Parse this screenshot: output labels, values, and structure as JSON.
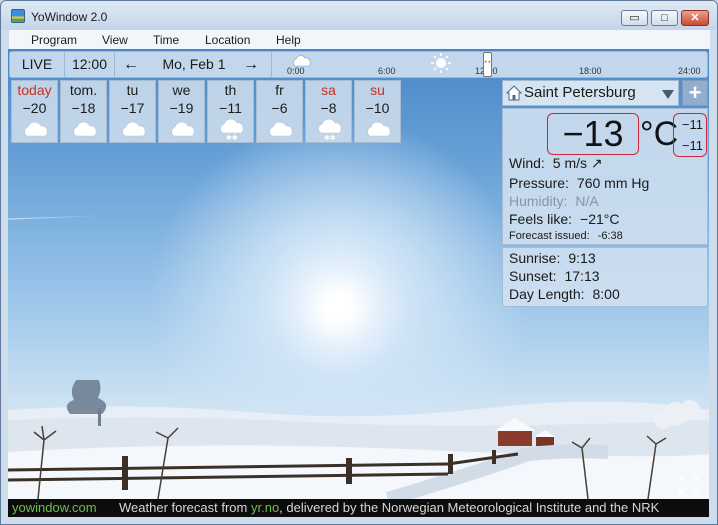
{
  "window": {
    "title": "YoWindow 2.0"
  },
  "window_controls": {
    "minimize": "▭",
    "maximize": "□",
    "close": "✕"
  },
  "menu": [
    "Program",
    "View",
    "Time",
    "Location",
    "Help"
  ],
  "toolbar": {
    "live_label": "LIVE",
    "time": "12:00",
    "date": "Mo, Feb 1",
    "prev_arrow": "←",
    "next_arrow": "→",
    "timeline_labels": [
      "0:00",
      "6:00",
      "12:00",
      "18:00",
      "24:00"
    ],
    "timeline_position": 0.5
  },
  "forecast": [
    {
      "day": "today",
      "temp": "−20",
      "icon": "cloud-icon",
      "weekend": true
    },
    {
      "day": "tom.",
      "temp": "−18",
      "icon": "cloud-icon",
      "weekend": false
    },
    {
      "day": "tu",
      "temp": "−17",
      "icon": "cloud-icon",
      "weekend": false
    },
    {
      "day": "we",
      "temp": "−19",
      "icon": "cloud-icon",
      "weekend": false
    },
    {
      "day": "th",
      "temp": "−11",
      "icon": "snow-cloud-icon",
      "weekend": false
    },
    {
      "day": "fr",
      "temp": "−6",
      "icon": "cloud-icon",
      "weekend": false
    },
    {
      "day": "sa",
      "temp": "−8",
      "icon": "snow-cloud-icon",
      "weekend": true
    },
    {
      "day": "su",
      "temp": "−10",
      "icon": "cloud-icon",
      "weekend": true
    }
  ],
  "current": {
    "city": "Saint Petersburg",
    "temperature": "−13",
    "unit": "°C",
    "range_high": "−11",
    "range_low": "−11",
    "wind_label": "Wind:",
    "wind_value": "5 m/s ↗",
    "pressure_label": "Pressure:",
    "pressure_value": "760 mm Hg",
    "humidity_label": "Humidity:",
    "humidity_value": "N/A",
    "feels_label": "Feels like:",
    "feels_value": "−21°C",
    "issued_label": "Forecast issued:",
    "issued_value": "-6:38",
    "sunrise_label": "Sunrise:",
    "sunrise_value": "9:13",
    "sunset_label": "Sunset:",
    "sunset_value": "17:13",
    "daylength_label": "Day Length:",
    "daylength_value": "8:00"
  },
  "footer": {
    "brand": "yowindow.com",
    "credit_prefix": "Weather forecast from ",
    "credit_link": "yr.no",
    "credit_suffix": ", delivered by the Norwegian Meteorological Institute and the NRK"
  },
  "colors": {
    "weekend": "#c8301f",
    "brand_green": "#6cc04a",
    "highlight_red": "#c8283c"
  }
}
